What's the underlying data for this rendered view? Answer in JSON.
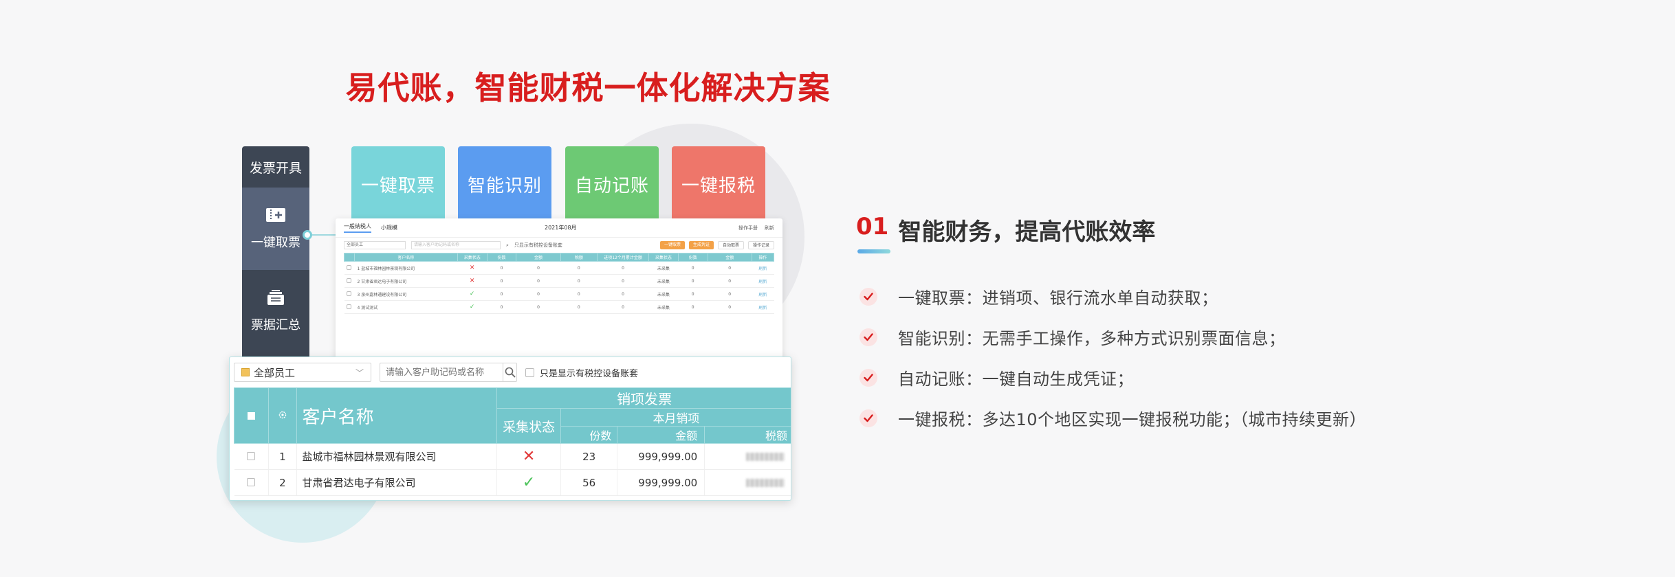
{
  "page_title": "易代账，智能财税一体化解决方案",
  "sidebar": {
    "header": "发票开具",
    "items": [
      {
        "label": "一键取票",
        "icon": "invoice-scan-icon"
      },
      {
        "label": "票据汇总",
        "icon": "receipt-stack-icon"
      }
    ]
  },
  "tiles": [
    "一键取票",
    "智能识别",
    "自动记账",
    "一键报税"
  ],
  "mini_table": {
    "tabs": [
      "一般纳税人",
      "小规模"
    ],
    "month": "2021年08月",
    "right_links": [
      "操作手册",
      "刷新"
    ],
    "select": "全部员工",
    "search_placeholder": "请输入客户助记码或名称",
    "checkbox": "只显示有税控设备账套",
    "buttons": [
      "一键取票",
      "生成凭证",
      "自动取票",
      "操作记录"
    ],
    "headers": [
      "客户名称",
      "采集状态",
      "销项发票",
      "份数",
      "金额",
      "税额",
      "进项12个月累计金额",
      "采集状态",
      "份数",
      "金额",
      "操作"
    ],
    "rows": [
      {
        "name": "1 盐城市福林园林景观有限公司",
        "status": "x",
        "a": "0",
        "b": "0",
        "c": "0",
        "d": "未采集",
        "e": "0",
        "f": "0",
        "op": "刷新"
      },
      {
        "name": "2 甘肃省君达电子有限公司",
        "status": "x",
        "a": "0",
        "b": "0",
        "c": "0",
        "d": "未采集",
        "e": "0",
        "f": "0",
        "op": "刷新"
      },
      {
        "name": "3 泉州嘉林通建设有限公司",
        "status": "ok",
        "a": "0",
        "b": "0",
        "c": "0",
        "d": "未采集",
        "e": "0",
        "f": "0",
        "op": "刷新"
      },
      {
        "name": "4 测试测试",
        "status": "ok",
        "a": "0",
        "b": "0",
        "c": "0",
        "d": "未采集",
        "e": "0",
        "f": "0",
        "op": "刷新"
      }
    ]
  },
  "big_table": {
    "select": "全部员工",
    "search_placeholder": "请输入客户助记码或名称",
    "checkbox": "只是显示有税控设备账套",
    "headers": {
      "customer": "客户名称",
      "group": "销项发票",
      "status": "采集状态",
      "month": "本月销项",
      "count": "份数",
      "amount": "金额",
      "tax": "税额"
    },
    "rows": [
      {
        "index": "1",
        "name": "盐城市福林园林景观有限公司",
        "status": "x",
        "count": "23",
        "amount": "999,999.00"
      },
      {
        "index": "2",
        "name": "甘肃省君达电子有限公司",
        "status": "ok",
        "count": "56",
        "amount": "999,999.00"
      }
    ]
  },
  "section": {
    "number": "01",
    "title": "智能财务，提高代账效率",
    "features": [
      "一键取票：进销项、银行流水单自动获取；",
      "智能识别：无需手工操作，多种方式识别票面信息；",
      "自动记账：一键自动生成凭证；",
      "一键报税：多达10个地区实现一键报税功能；（城市持续更新）"
    ]
  },
  "colors": {
    "title_red": "#d81e1e",
    "teal": "#74c7cc",
    "tile_teal": "#79d5da",
    "tile_blue": "#5b9cf0",
    "tile_green": "#6dc974",
    "tile_red": "#ee766a",
    "sidebar": "#3d4654"
  }
}
